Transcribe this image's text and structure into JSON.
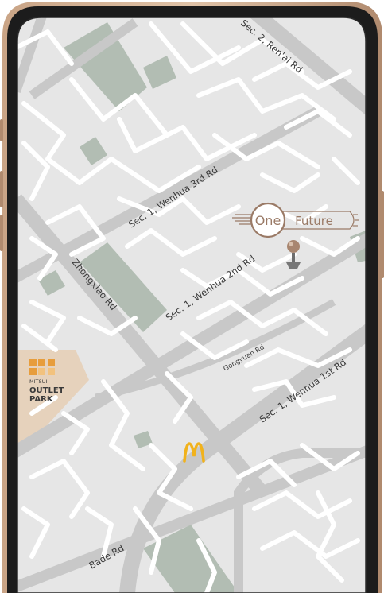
{
  "map": {
    "roads": {
      "ren_ai": "Sec. 2, Ren'ai Rd",
      "wenhua_3rd": "Sec. 1, Wenhua 3rd Rd",
      "wenhua_2nd": "Sec. 1, Wenhua 2nd Rd",
      "zhongxiao": "Zhongxiao Rd",
      "gongyuan": "Gongyuan Rd",
      "wenhua_1st": "Sec. 1, Wenhua 1st Rd",
      "bade": "Bade Rd"
    },
    "landmarks": {
      "one_future": {
        "word1": "One",
        "word2": "Future"
      },
      "mitsui": {
        "logo": "M P",
        "line1": "MITSUI",
        "line2": "OUTLET",
        "line3": "PARK"
      },
      "mcdonalds": {
        "logo": "M"
      }
    },
    "colors": {
      "land": "#e6e6e6",
      "major_road": "#c8c8c8",
      "minor_road": "#ffffff",
      "park": "#b2bdb3",
      "outlet": "#e6d2bc",
      "brand_copper": "#9a7a66",
      "mcdonalds": "#f1b21c",
      "frame": "#b08a6e"
    },
    "pin_icon": "map-pin-icon"
  }
}
